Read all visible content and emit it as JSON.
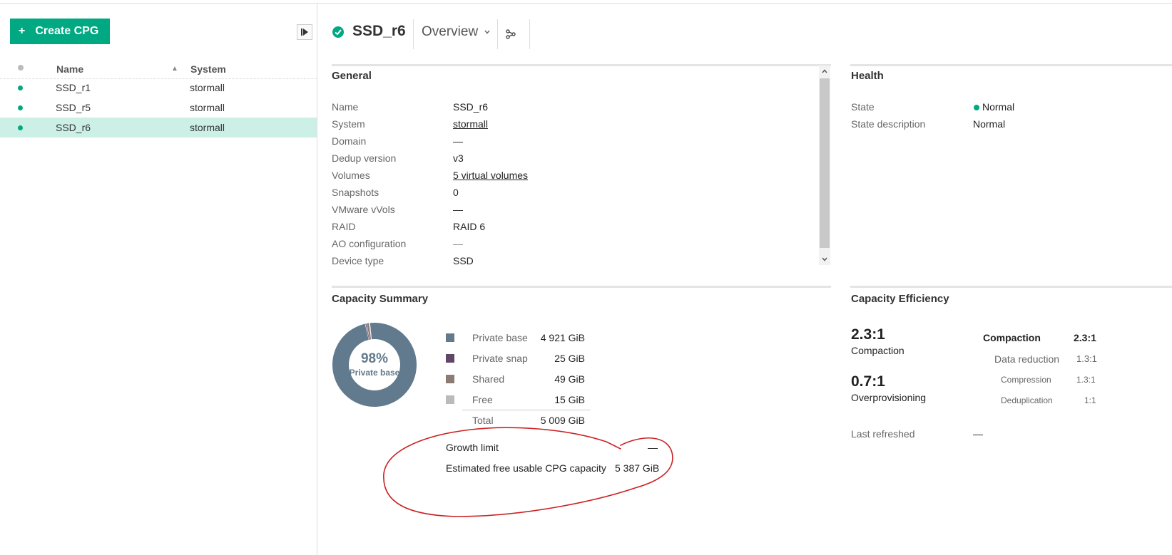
{
  "sidebar": {
    "create_label": "Create CPG",
    "columns": {
      "name": "Name",
      "system": "System"
    },
    "rows": [
      {
        "name": "SSD_r1",
        "system": "stormall"
      },
      {
        "name": "SSD_r5",
        "system": "stormall"
      },
      {
        "name": "SSD_r6",
        "system": "stormall",
        "selected": true
      }
    ]
  },
  "header": {
    "title": "SSD_r6",
    "view": "Overview"
  },
  "general": {
    "title": "General",
    "rows": [
      {
        "label": "Name",
        "value": "SSD_r6"
      },
      {
        "label": "System",
        "value": "stormall"
      },
      {
        "label": "Domain",
        "value": "—"
      },
      {
        "label": "Dedup version",
        "value": "v3"
      },
      {
        "label": "Volumes",
        "value": "5 virtual volumes"
      },
      {
        "label": "Snapshots",
        "value": "0"
      },
      {
        "label": "VMware vVols",
        "value": "—"
      },
      {
        "label": "RAID",
        "value": "RAID 6"
      },
      {
        "label": "AO configuration",
        "value": "—"
      },
      {
        "label": "Device type",
        "value": "SSD"
      }
    ]
  },
  "health": {
    "title": "Health",
    "state_label": "State",
    "state_value": "Normal",
    "desc_label": "State description",
    "desc_value": "Normal"
  },
  "capacity": {
    "title": "Capacity Summary",
    "donut_percent": "98%",
    "donut_label": "Private base",
    "items": [
      {
        "label": "Private base",
        "value": "4 921 GiB",
        "color": "#627a8d",
        "gib": 4921
      },
      {
        "label": "Private snap",
        "value": "25 GiB",
        "color": "#614767",
        "gib": 25
      },
      {
        "label": "Shared",
        "value": "49 GiB",
        "color": "#8c7b75",
        "gib": 49
      },
      {
        "label": "Free",
        "value": "15 GiB",
        "color": "#bbbbbb",
        "gib": 15
      }
    ],
    "total_label": "Total",
    "total_value": "5 009 GiB",
    "growth_label": "Growth limit",
    "growth_value": "—",
    "est_label": "Estimated free usable CPG capacity",
    "est_value": "5 387 GiB"
  },
  "efficiency": {
    "title": "Capacity Efficiency",
    "compaction_big": "2.3:1",
    "compaction_big_label": "Compaction",
    "overprov_big": "0.7:1",
    "overprov_big_label": "Overprovisioning",
    "table": [
      {
        "label": "Compaction",
        "value": "2.3:1"
      },
      {
        "label": "Data reduction",
        "value": "1.3:1"
      },
      {
        "label": "Compression",
        "value": "1.3:1"
      },
      {
        "label": "Deduplication",
        "value": "1:1"
      }
    ],
    "refreshed_label": "Last refreshed",
    "refreshed_value": "—"
  },
  "colors": {
    "accent": "#01a982",
    "selected_row": "#ccefe6",
    "annotation": "#cc2222"
  }
}
